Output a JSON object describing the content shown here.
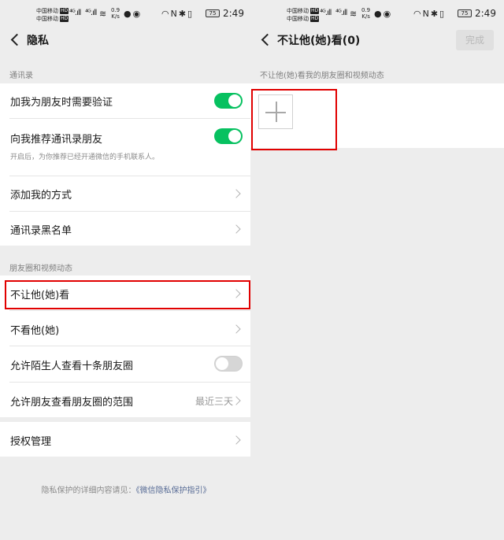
{
  "status_bar": {
    "carrier1": "中国移动",
    "carrier2": "中国移动",
    "hd_badge": "HD",
    "signal1": "⁴ᴳ.ıll",
    "signal2": "⁴ᴳ.ıll",
    "net_speed_value": "0.9",
    "net_speed_unit": "K/s",
    "battery": "75",
    "time": "2:49"
  },
  "left": {
    "title": "隐私",
    "sections": {
      "contacts_header": "通讯录",
      "moments_header": "朋友圈和视频动态"
    },
    "rows": {
      "verify_label": "加我为朋友时需要验证",
      "verify_on": true,
      "recommend_label": "向我推荐通讯录朋友",
      "recommend_sub": "开启后，为你推荐已经开通微信的手机联系人。",
      "recommend_on": true,
      "add_methods_label": "添加我的方式",
      "blacklist_label": "通讯录黑名单",
      "hide_from_label": "不让他(她)看",
      "dont_see_label": "不看他(她)",
      "stranger_label": "允许陌生人查看十条朋友圈",
      "stranger_on": false,
      "range_label": "允许朋友查看朋友圈的范围",
      "range_value": "最近三天",
      "auth_label": "授权管理"
    },
    "footer_text": "隐私保护的详细内容请见：",
    "footer_link": "《微信隐私保护指引》"
  },
  "right": {
    "title": "不让他(她)看(0)",
    "done_label": "完成",
    "hint": "不让他(她)看我的朋友圈和视频动态"
  },
  "colors": {
    "accent_green": "#07c160",
    "highlight_red": "#e10000",
    "link_blue": "#576b95"
  }
}
